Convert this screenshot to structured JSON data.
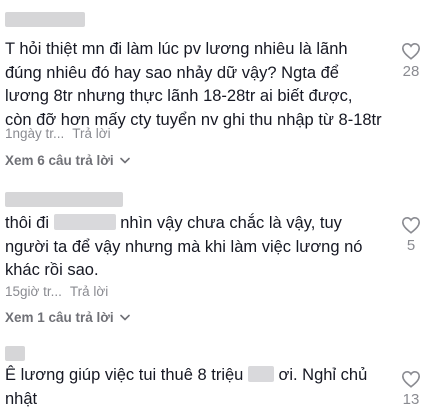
{
  "comments": [
    {
      "text": "T hỏi thiệt mn đi làm lúc pv lương nhiêu là lãnh đúng nhiêu đó hay sao nhảy dữ vậy? Ngta để lương 8tr nhưng thực lãnh 18-28tr ai biết được, còn đỡ hơn mấy cty tuyển nv ghi thu nhập từ 8-18tr",
      "meta_time": "1ngày tr...",
      "reply_label": "Trả lời",
      "likes": "28",
      "view_replies": "Xem 6 câu trả lời"
    },
    {
      "text_before": "thôi đi ",
      "text_after": " nhìn vậy chưa chắc là vậy, tuy người ta để vậy nhưng mà khi làm việc lương nó khác rồi sao.",
      "meta_time": "15giờ tr...",
      "reply_label": "Trả lời",
      "likes": "5",
      "view_replies": "Xem 1 câu trả lời"
    },
    {
      "text_before": "Ê lương giúp việc tui thuê 8 triệu ",
      "text_after": " ơi. Nghỉ chủ nhật",
      "likes": "13"
    }
  ],
  "icons": {
    "like": "heart-outline-icon",
    "expand": "chevron-down-icon"
  },
  "colors": {
    "text": "#161823",
    "muted": "#8a8b91",
    "blur": "#d6d6d8"
  }
}
